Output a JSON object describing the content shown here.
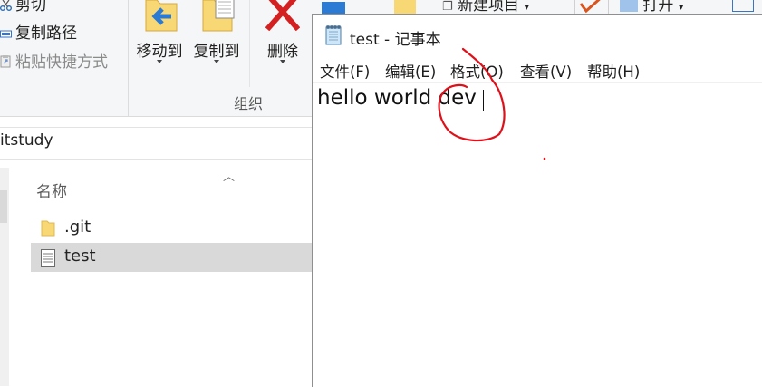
{
  "explorer": {
    "clipboard": {
      "cut_label": "剪切",
      "copy_path_label": "复制路径",
      "paste_shortcut_label": "粘贴快捷方式"
    },
    "organize": {
      "move_to_label": "移动到",
      "copy_to_label": "复制到",
      "delete_label": "删除",
      "group_label": "组织"
    },
    "new_item_label": "新建项目",
    "open_label": "打开",
    "address_text": "itstudy",
    "column_header": "名称",
    "files": [
      {
        "name": ".git",
        "icon": "folder-icon",
        "selected": false
      },
      {
        "name": "test",
        "icon": "text-file-icon",
        "selected": true
      }
    ],
    "colors": {
      "ribbon_bg": "#f5f6f7",
      "selection": "#d9d9d9",
      "folder": "#f8d775",
      "delete_x": "#d42020"
    }
  },
  "notepad": {
    "title": "test - 记事本",
    "menu": [
      {
        "label": "文件(F)"
      },
      {
        "label": "编辑(E)"
      },
      {
        "label": "格式(O)"
      },
      {
        "label": "查看(V)"
      },
      {
        "label": "帮助(H)"
      }
    ],
    "content": "hello world dev",
    "annotation_color": "#e0101a"
  }
}
